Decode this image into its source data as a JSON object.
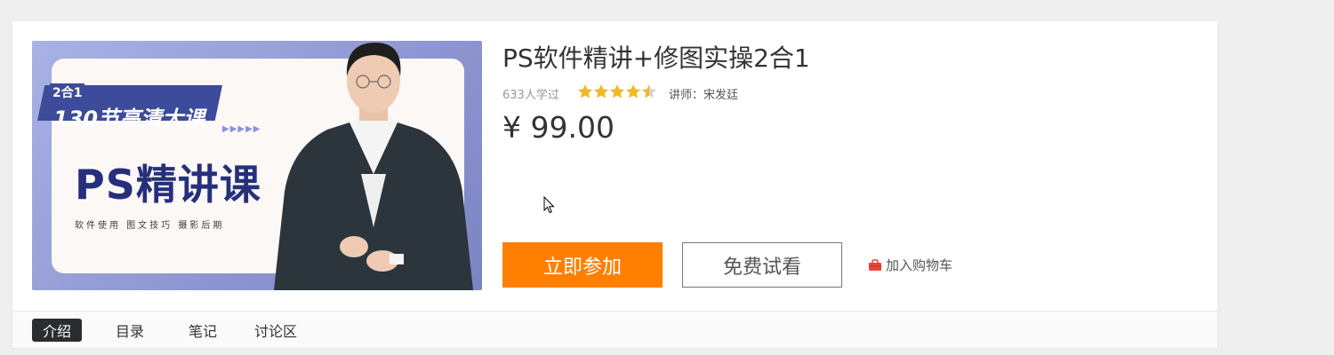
{
  "cover": {
    "badge_top": "2合1",
    "badge_main": "130节高清大课",
    "arrows": "▶▶▶▶▶",
    "title": "PS精讲课",
    "subtitle": "软件使用  图文技巧  摄影后期"
  },
  "course": {
    "title": "PS软件精讲+修图实操2合1",
    "students": "633人学过",
    "rating": 4.5,
    "teacher": "讲师：宋发廷",
    "price": "¥ 99.00"
  },
  "actions": {
    "join": "立即参加",
    "trial": "免费试看",
    "cart": "加入购物车"
  },
  "tabs": [
    {
      "label": "介绍",
      "active": true
    },
    {
      "label": "目录",
      "active": false
    },
    {
      "label": "笔记",
      "active": false
    },
    {
      "label": "讨论区",
      "active": false
    }
  ],
  "colors": {
    "accent_orange": "#ff7f00",
    "star_gold": "#f5b823",
    "cart_red": "#e8453c",
    "active_tab_bg": "#2b2c30"
  }
}
